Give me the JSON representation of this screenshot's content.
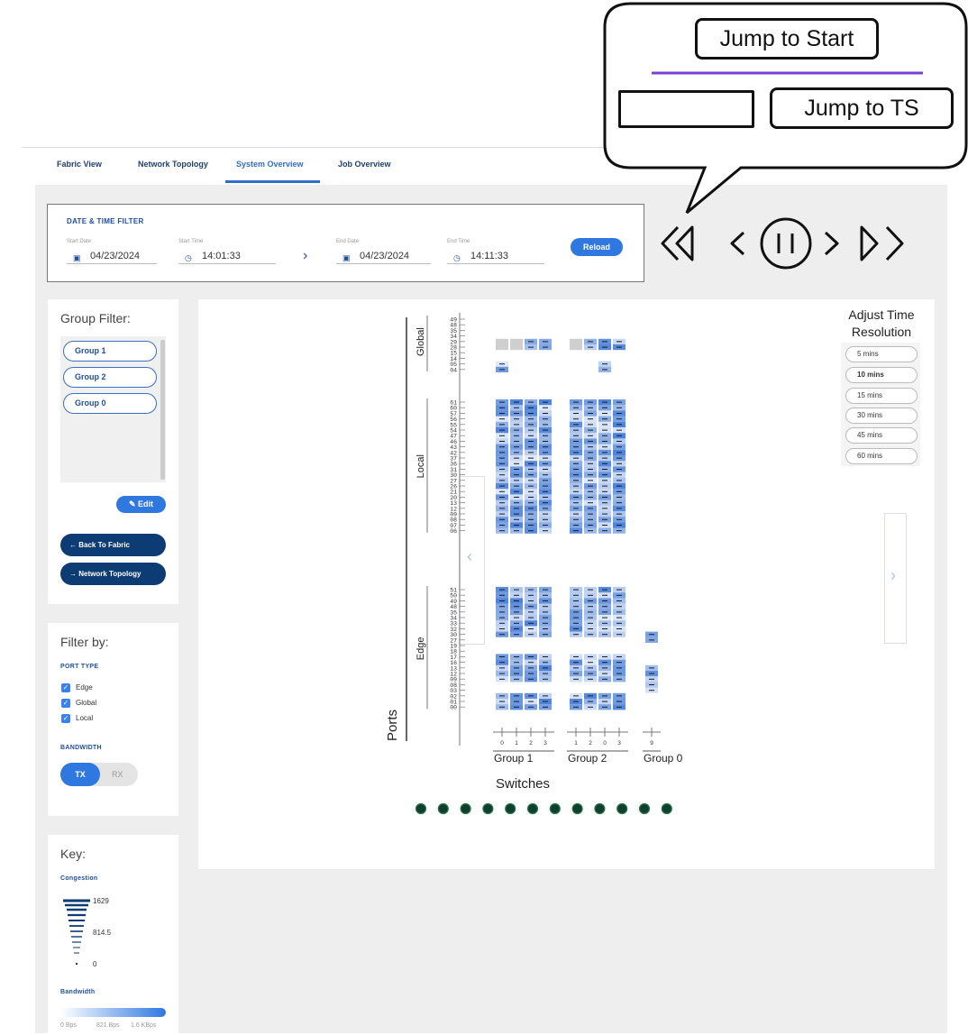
{
  "tabs": [
    "Fabric View",
    "Network Topology",
    "System Overview",
    "Job Overview"
  ],
  "active_tab": "System Overview",
  "datetime_filter": {
    "title": "DATE & TIME FILTER",
    "start_date_label": "Start Date",
    "start_date": "04/23/2024",
    "start_time_label": "Start Time",
    "start_time": "14:01:33",
    "end_date_label": "End Date",
    "end_date": "04/23/2024",
    "end_time_label": "End Time",
    "end_time": "14:11:33",
    "reload_label": "Reload"
  },
  "group_filter": {
    "title": "Group Filter:",
    "groups": [
      "Group 1",
      "Group 2",
      "Group 0"
    ],
    "edit_label": "Edit",
    "back_label": "Back To Fabric",
    "topology_label": "Network Topology"
  },
  "filter_by": {
    "title": "Filter by:",
    "port_type_label": "PORT TYPE",
    "port_types": [
      "Edge",
      "Global",
      "Local"
    ],
    "bandwidth_label": "BANDWIDTH",
    "bandwidth_on": "TX",
    "bandwidth_off": "RX"
  },
  "key": {
    "title": "Key:",
    "congestion_label": "Congestion",
    "congestion_values": [
      "1629",
      "814.5",
      "0"
    ],
    "bandwidth_label": "Bandwidth",
    "bandwidth_values": [
      "0 Bps",
      "821 Bps",
      "1.6 KBps"
    ]
  },
  "time_resolution": {
    "title": "Adjust Time Resolution",
    "options": [
      "5 mins",
      "10 mins",
      "15 mins",
      "30 mins",
      "45 mins",
      "60 mins"
    ],
    "selected": "10 mins"
  },
  "heatmap": {
    "y_axis_label": "Ports",
    "x_axis_label": "Switches",
    "sections": [
      {
        "name": "Global",
        "ports": [
          "49",
          "48",
          "35",
          "34",
          "29",
          "28",
          "15",
          "14",
          "05",
          "04"
        ]
      },
      {
        "name": "Local",
        "ports": [
          "61",
          "60",
          "57",
          "56",
          "55",
          "54",
          "47",
          "46",
          "43",
          "42",
          "37",
          "36",
          "31",
          "30",
          "27",
          "26",
          "21",
          "20",
          "13",
          "12",
          "09",
          "08",
          "07",
          "06"
        ]
      },
      {
        "name": "Edge",
        "ports": [
          "51",
          "50",
          "49",
          "48",
          "35",
          "34",
          "33",
          "32",
          "30",
          "27",
          "19",
          "18",
          "17",
          "16",
          "13",
          "12",
          "09",
          "08",
          "03",
          "02",
          "01",
          "00"
        ]
      }
    ],
    "groups": [
      {
        "name": "Group 1",
        "switches": [
          "0",
          "1",
          "2",
          "3"
        ]
      },
      {
        "name": "Group 2",
        "switches": [
          "1",
          "2",
          "0",
          "3"
        ]
      },
      {
        "name": "Group 0",
        "switches": [
          "9"
        ]
      }
    ],
    "page_dots": 12
  },
  "tooltip": {
    "jump_start_label": "Jump to Start",
    "jump_ts_label": "Jump to TS",
    "ts_value": ""
  },
  "colors": {
    "accent": "#2f78e0",
    "navy": "#0d3b73",
    "tooltip_line": "#7b3fd6",
    "dot": "#0f3f2f"
  }
}
